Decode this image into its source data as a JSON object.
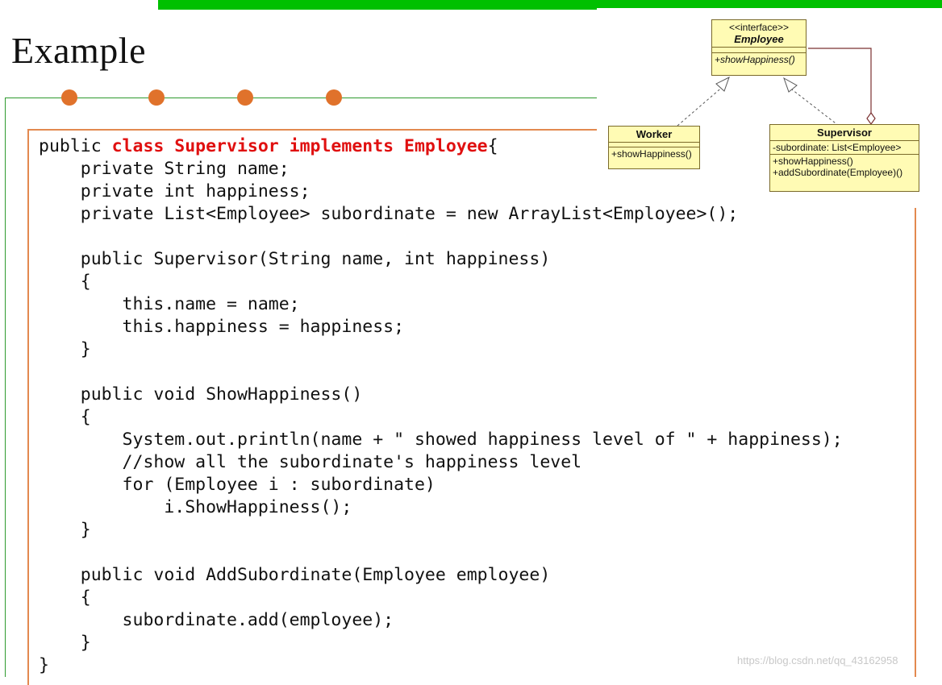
{
  "slide": {
    "title": "Example"
  },
  "code": {
    "lines": [
      [
        {
          "t": "public "
        },
        {
          "t": "class Supervisor implements Employee",
          "kw": true
        },
        {
          "t": "{"
        }
      ],
      [
        {
          "t": "    private String name;"
        }
      ],
      [
        {
          "t": "    private int happiness;"
        }
      ],
      [
        {
          "t": "    private List<Employee> subordinate = new ArrayList<Employee>();"
        }
      ],
      [
        {
          "t": ""
        }
      ],
      [
        {
          "t": "    public Supervisor(String name, int happiness)"
        }
      ],
      [
        {
          "t": "    {"
        }
      ],
      [
        {
          "t": "        this.name = name;"
        }
      ],
      [
        {
          "t": "        this.happiness = happiness;"
        }
      ],
      [
        {
          "t": "    }"
        }
      ],
      [
        {
          "t": ""
        }
      ],
      [
        {
          "t": "    public void ShowHappiness()"
        }
      ],
      [
        {
          "t": "    {"
        }
      ],
      [
        {
          "t": "        System.out.println(name + \" showed happiness level of \" + happiness);"
        }
      ],
      [
        {
          "t": "        //show all the subordinate's happiness level"
        }
      ],
      [
        {
          "t": "        for (Employee i : subordinate)"
        }
      ],
      [
        {
          "t": "            i.ShowHappiness();"
        }
      ],
      [
        {
          "t": "    }"
        }
      ],
      [
        {
          "t": ""
        }
      ],
      [
        {
          "t": "    public void AddSubordinate(Employee employee)"
        }
      ],
      [
        {
          "t": "    {"
        }
      ],
      [
        {
          "t": "        subordinate.add(employee);"
        }
      ],
      [
        {
          "t": "    }"
        }
      ],
      [
        {
          "t": "}"
        }
      ]
    ]
  },
  "uml": {
    "employee": {
      "stereotype": "<<interface>>",
      "name": "Employee",
      "methods": [
        "+showHappiness()"
      ]
    },
    "worker": {
      "name": "Worker",
      "methods": [
        "+showHappiness()"
      ]
    },
    "supervisor": {
      "name": "Supervisor",
      "attributes": [
        "-subordinate: List<Employee>"
      ],
      "methods": [
        "+showHappiness()",
        "+addSubordinate(Employee)()"
      ]
    }
  },
  "watermark": "https://blog.csdn.net/qq_43162958",
  "colors": {
    "accent_green": "#00c000",
    "orange": "#e0722b",
    "keyword_red": "#e01010",
    "uml_fill": "#fffbb4"
  }
}
